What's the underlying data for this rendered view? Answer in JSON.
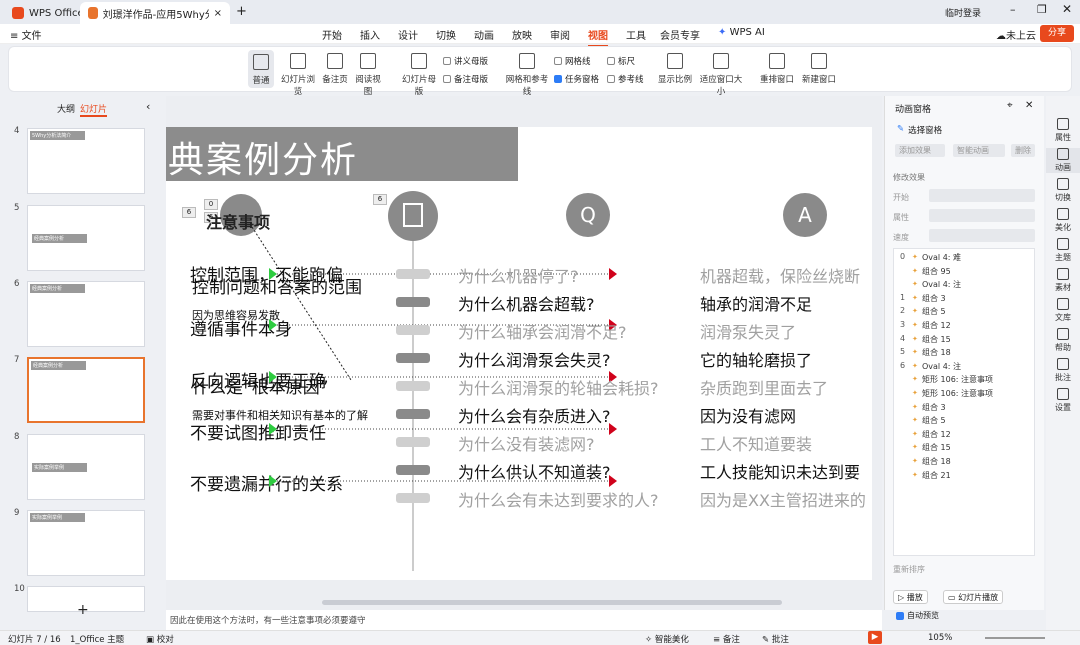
{
  "tabs": [
    {
      "label": "WPS Office"
    },
    {
      "label": "刘璟洋作品-应用5Why分析..."
    }
  ],
  "titlebar": {
    "login": "临时登录"
  },
  "menu": {
    "file": "文件",
    "items": [
      "开始",
      "插入",
      "设计",
      "切换",
      "动画",
      "放映",
      "审阅",
      "视图",
      "工具",
      "会员专享"
    ],
    "active": "视图",
    "wpsai": "WPS AI",
    "cloud": "未上云",
    "share": "分享"
  },
  "ribbon": {
    "buttons": [
      "普通",
      "幻灯片浏览",
      "备注页",
      "阅读视图",
      "幻灯片母版",
      "讲义母版",
      "备注母版",
      "网格和参考线",
      "任务窗格",
      "网格线",
      "参考线",
      "标尺",
      "显示比例",
      "适应窗口大小",
      "重排窗口",
      "新建窗口"
    ]
  },
  "left": {
    "tab_outline": "大纲",
    "tab_slides": "幻灯片",
    "add": "+",
    "slides": [
      {
        "n": "4",
        "title": "5Why分析法简介"
      },
      {
        "n": "5",
        "title": "经典案例分析"
      },
      {
        "n": "6",
        "title": "经典案例分析"
      },
      {
        "n": "7",
        "title": "经典案例分析"
      },
      {
        "n": "8",
        "title": "实际案例举例"
      },
      {
        "n": "9",
        "title": "实际案例举例"
      },
      {
        "n": "10",
        "title": ""
      }
    ]
  },
  "slide": {
    "title": "典案例分析",
    "q": "Q",
    "a": "A",
    "tags": [
      "6",
      "0",
      "6",
      "6"
    ],
    "left_items": [
      "控制范围，不能跑偏",
      "控制问题和答案的范围",
      "因为思维容易发散",
      "遵循事件本身",
      "反向逻辑也要正确",
      "什么是“根本原因”",
      "需要对事件和相关知识有基本的了解",
      "不要试图推卸责任",
      "不要遗漏并行的关系"
    ],
    "note_title": "注意事项",
    "rows": [
      {
        "q": "为什么机器停了?",
        "a": "机器超载，保险丝烧断",
        "dim": true
      },
      {
        "q": "为什么机器会超载?",
        "a": "轴承的润滑不足",
        "dim": false
      },
      {
        "q": "为什么轴承会润滑不足?",
        "a": "润滑泵失灵了",
        "dim": true
      },
      {
        "q": "为什么润滑泵会失灵?",
        "a": "它的轴轮磨损了",
        "dim": false
      },
      {
        "q": "为什么润滑泵的轮轴会耗损?",
        "a": "杂质跑到里面去了",
        "dim": true
      },
      {
        "q": "为什么会有杂质进入?",
        "a": "因为没有滤网",
        "dim": false
      },
      {
        "q": "为什么没有装滤网?",
        "a": "工人不知道要装",
        "dim": true
      },
      {
        "q": "为什么供认不知道装?",
        "a": "工人技能知识未达到要",
        "dim": false
      },
      {
        "q": "为什么会有未达到要求的人?",
        "a": "因为是XX主管招进来的",
        "dim": true
      }
    ]
  },
  "notes": "因此在使用这个方法时，有一些注意事项必须要遵守",
  "anim": {
    "title": "动画窗格",
    "select": "选择窗格",
    "add": "添加效果",
    "smart": "智能动画",
    "del": "删除",
    "modify": "修改效果",
    "start": "开始",
    "prop": "属性",
    "speed": "速度",
    "list": [
      {
        "n": "0",
        "label": "Oval 4: 难"
      },
      {
        "n": "",
        "label": "组合 95"
      },
      {
        "n": "",
        "label": "Oval 4: 注"
      },
      {
        "n": "1",
        "label": "组合 3"
      },
      {
        "n": "2",
        "label": "组合 5"
      },
      {
        "n": "3",
        "label": "组合 12"
      },
      {
        "n": "4",
        "label": "组合 15"
      },
      {
        "n": "5",
        "label": "组合 18"
      },
      {
        "n": "6",
        "label": "Oval 4: 注"
      },
      {
        "n": "",
        "label": "矩形 106: 注意事项"
      },
      {
        "n": "",
        "label": "矩形 106: 注意事项"
      },
      {
        "n": "",
        "label": "组合 3"
      },
      {
        "n": "",
        "label": "组合 5"
      },
      {
        "n": "",
        "label": "组合 12"
      },
      {
        "n": "",
        "label": "组合 15"
      },
      {
        "n": "",
        "label": "组合 18"
      },
      {
        "n": "",
        "label": "组合 21"
      }
    ],
    "reorder": "重新排序",
    "play": "播放",
    "slideplay": "幻灯片播放",
    "autopreview": "自动预览"
  },
  "rside": [
    "属性",
    "动画",
    "切换",
    "美化",
    "主题",
    "素材",
    "文库",
    "帮助",
    "批注",
    "设置"
  ],
  "status": {
    "slide": "幻灯片 7 / 16",
    "theme": "1_Office 主题",
    "proof": "校对",
    "beautify": "智能美化",
    "notes": "备注",
    "comment": "批注",
    "zoom": "105%"
  }
}
